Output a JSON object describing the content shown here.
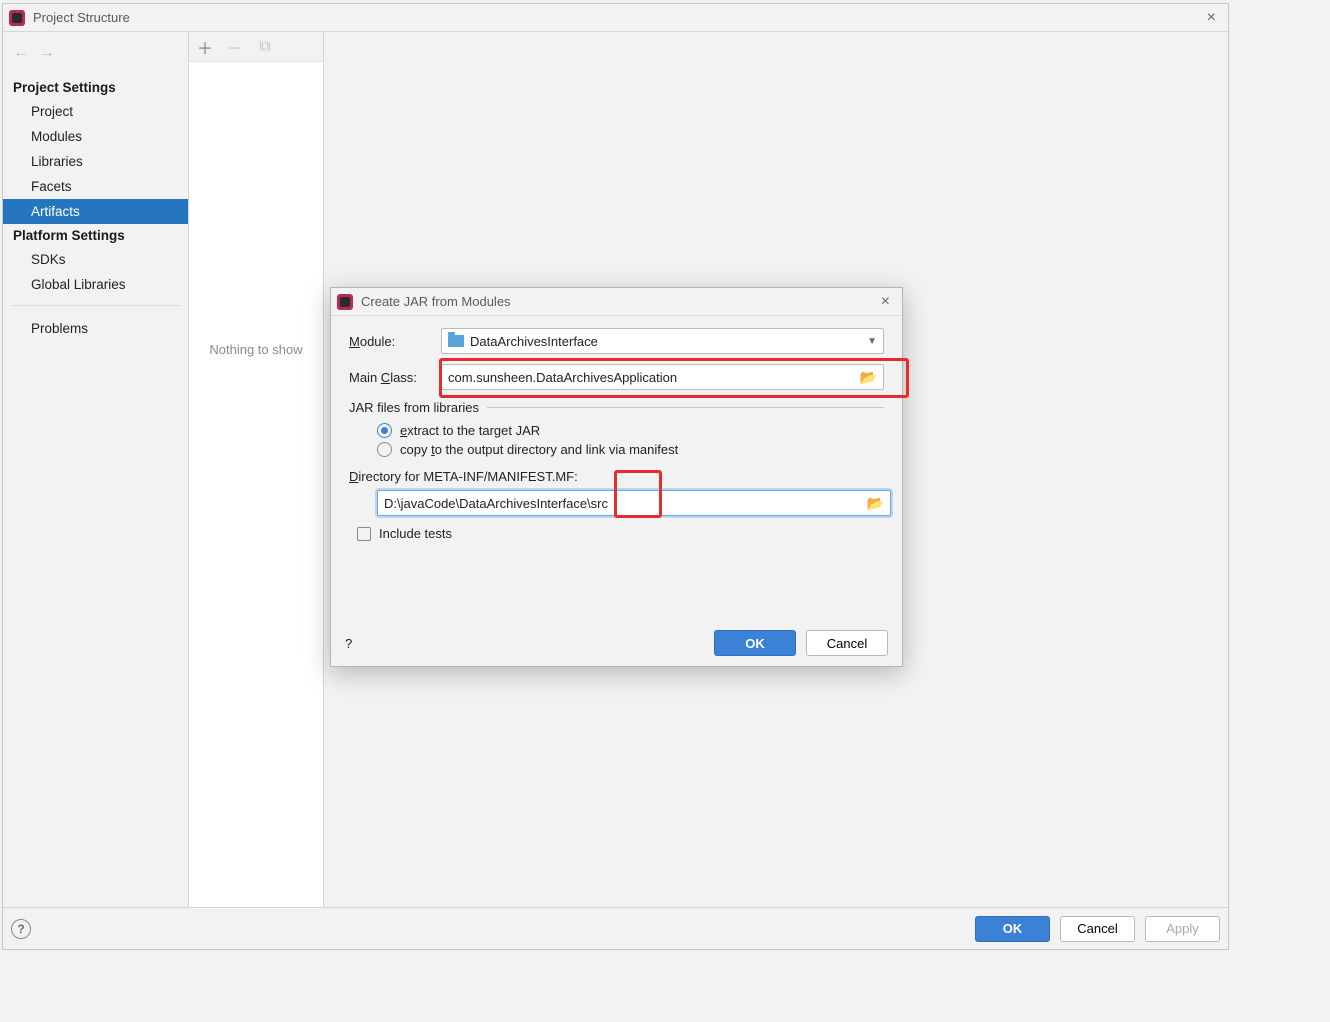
{
  "mainWindow": {
    "title": "Project Structure",
    "sidebar": {
      "section1": {
        "header": "Project Settings",
        "items": [
          "Project",
          "Modules",
          "Libraries",
          "Facets",
          "Artifacts"
        ]
      },
      "section2": {
        "header": "Platform Settings",
        "items": [
          "SDKs",
          "Global Libraries"
        ]
      },
      "section3": {
        "items": [
          "Problems"
        ]
      }
    },
    "listPanel": {
      "emptyText": "Nothing to show"
    },
    "footer": {
      "ok": "OK",
      "cancel": "Cancel",
      "apply": "Apply"
    }
  },
  "modal": {
    "title": "Create JAR from Modules",
    "moduleLabel": "Module:",
    "moduleValue": "DataArchivesInterface",
    "mainClassLabel": "Main Class:",
    "mainClassValue": "com.sunsheen.DataArchivesApplication",
    "jarGroupLabel": "JAR files from libraries",
    "radio1": "extract to the target JAR",
    "radio2": "copy to the output directory and link via manifest",
    "dirLabel": "Directory for META-INF/MANIFEST.MF:",
    "dirValue": "D:\\javaCode\\DataArchivesInterface\\src",
    "includeTests": "Include tests",
    "ok": "OK",
    "cancel": "Cancel"
  }
}
